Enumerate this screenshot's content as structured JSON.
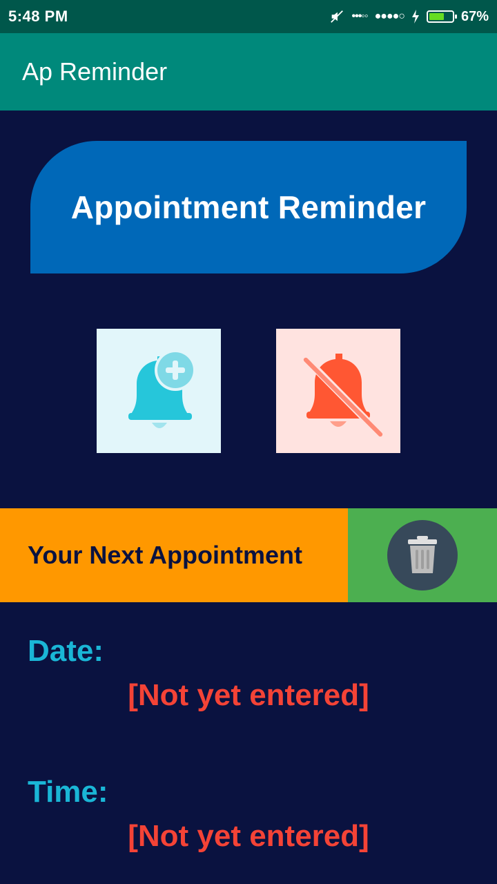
{
  "status_bar": {
    "time": "5:48 PM",
    "battery_percent": "67%",
    "battery_level": 0.67,
    "icons": [
      "mute-icon",
      "signal-dots-icon",
      "signal-strength-icon",
      "charging-icon",
      "battery-icon"
    ]
  },
  "app_bar": {
    "title": "Ap Reminder"
  },
  "hero": {
    "title": "Appointment Reminder"
  },
  "actions": {
    "add_icon": "bell-plus-icon",
    "off_icon": "bell-off-icon",
    "add_color": "#26c6da",
    "off_color": "#ff5733"
  },
  "next_appointment": {
    "heading": "Your Next Appointment",
    "delete_icon": "trash-icon"
  },
  "details": {
    "date_label": "Date:",
    "date_value": "[Not yet entered]",
    "time_label": "Time:",
    "time_value": "[Not yet entered]"
  },
  "colors": {
    "background": "#0a1240",
    "status_bar": "#00574b",
    "app_bar": "#00897b",
    "hero": "#0068b8",
    "next_bar": "#ff9800",
    "delete_bg": "#4caf50",
    "label": "#1ab6d6",
    "value": "#f44336"
  }
}
